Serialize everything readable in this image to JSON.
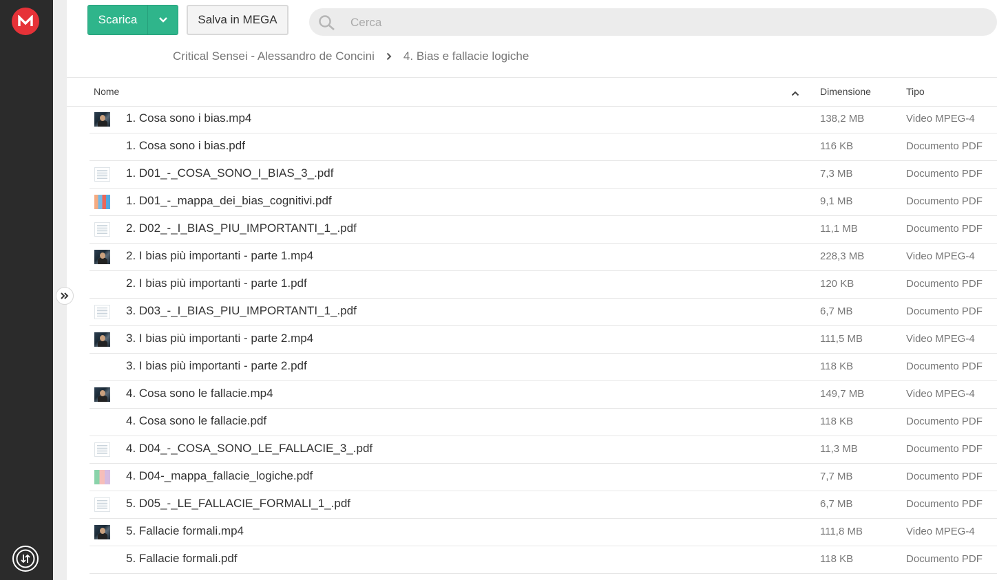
{
  "toolbar": {
    "download_label": "Scarica",
    "save_label": "Salva in MEGA",
    "search_placeholder": "Cerca"
  },
  "breadcrumb": [
    "Critical Sensei - Alessandro de Concini",
    "4. Bias e fallacie logiche"
  ],
  "table": {
    "columns": {
      "name": "Nome",
      "size": "Dimensione",
      "type": "Tipo"
    },
    "rows": [
      {
        "name": "1. Cosa sono i bias.mp4",
        "size": "138,2 MB",
        "type": "Video MPEG-4",
        "thumb": "video"
      },
      {
        "name": "1. Cosa sono i bias.pdf",
        "size": "116 KB",
        "type": "Documento PDF",
        "thumb": "none"
      },
      {
        "name": "1. D01_-_COSA_SONO_I_BIAS_3_.pdf",
        "size": "7,3 MB",
        "type": "Documento PDF",
        "thumb": "doc"
      },
      {
        "name": "1. D01_-_mappa_dei_bias_cognitivi.pdf",
        "size": "9,1 MB",
        "type": "Documento PDF",
        "thumb": "map"
      },
      {
        "name": "2. D02_-_I_BIAS_PIU_IMPORTANTI_1_.pdf",
        "size": "11,1 MB",
        "type": "Documento PDF",
        "thumb": "doc"
      },
      {
        "name": "2. I bias più importanti - parte 1.mp4",
        "size": "228,3 MB",
        "type": "Video MPEG-4",
        "thumb": "video"
      },
      {
        "name": "2. I bias più importanti - parte 1.pdf",
        "size": "120 KB",
        "type": "Documento PDF",
        "thumb": "none"
      },
      {
        "name": "3. D03_-_I_BIAS_PIU_IMPORTANTI_1_.pdf",
        "size": "6,7 MB",
        "type": "Documento PDF",
        "thumb": "doc"
      },
      {
        "name": "3. I bias più importanti - parte 2.mp4",
        "size": "111,5 MB",
        "type": "Video MPEG-4",
        "thumb": "video"
      },
      {
        "name": "3. I bias più importanti - parte 2.pdf",
        "size": "118 KB",
        "type": "Documento PDF",
        "thumb": "none"
      },
      {
        "name": "4. Cosa sono le fallacie.mp4",
        "size": "149,7 MB",
        "type": "Video MPEG-4",
        "thumb": "video"
      },
      {
        "name": "4. Cosa sono le fallacie.pdf",
        "size": "118 KB",
        "type": "Documento PDF",
        "thumb": "none"
      },
      {
        "name": "4. D04_-_COSA_SONO_LE_FALLACIE_3_.pdf",
        "size": "11,3 MB",
        "type": "Documento PDF",
        "thumb": "doc"
      },
      {
        "name": "4. D04-_mappa_fallacie_logiche.pdf",
        "size": "7,7 MB",
        "type": "Documento PDF",
        "thumb": "map2"
      },
      {
        "name": "5. D05_-_LE_FALLACIE_FORMALI_1_.pdf",
        "size": "6,7 MB",
        "type": "Documento PDF",
        "thumb": "doc"
      },
      {
        "name": "5. Fallacie formali.mp4",
        "size": "111,8 MB",
        "type": "Video MPEG-4",
        "thumb": "video"
      },
      {
        "name": "5. Fallacie formali.pdf",
        "size": "118 KB",
        "type": "Documento PDF",
        "thumb": "none"
      }
    ]
  },
  "icons": {
    "logo": "mega-logo-icon",
    "transfers": "transfer-manager-icon",
    "expand": "expand-sidebar-icon",
    "search": "search-icon",
    "sort": "sort-ascending-icon",
    "dropdown": "chevron-down-icon",
    "breadcrumb_sep": "chevron-right-icon"
  },
  "colors": {
    "brand": "#e63238",
    "download_button": "#2fb58b",
    "sidebar": "#2b2b2b"
  }
}
